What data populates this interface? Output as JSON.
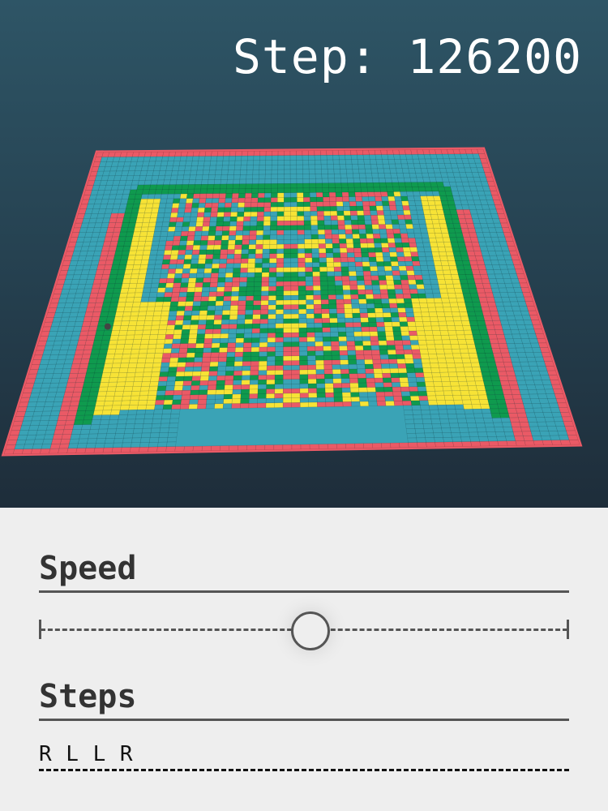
{
  "game": {
    "step_label": "Step: 126200",
    "colors": {
      "background_top": "#2e5566",
      "background_bottom": "#1e2d3a",
      "cell_cyan": "#3aa3b6",
      "cell_red": "#ea5a66",
      "cell_yellow": "#f7e336",
      "cell_green": "#0f9a4e",
      "ant": "#444444"
    },
    "rule": "RLLR"
  },
  "controls": {
    "speed_title": "Speed",
    "speed_value": 0.51,
    "steps_title": "Steps",
    "steps_value": "R L L R"
  }
}
